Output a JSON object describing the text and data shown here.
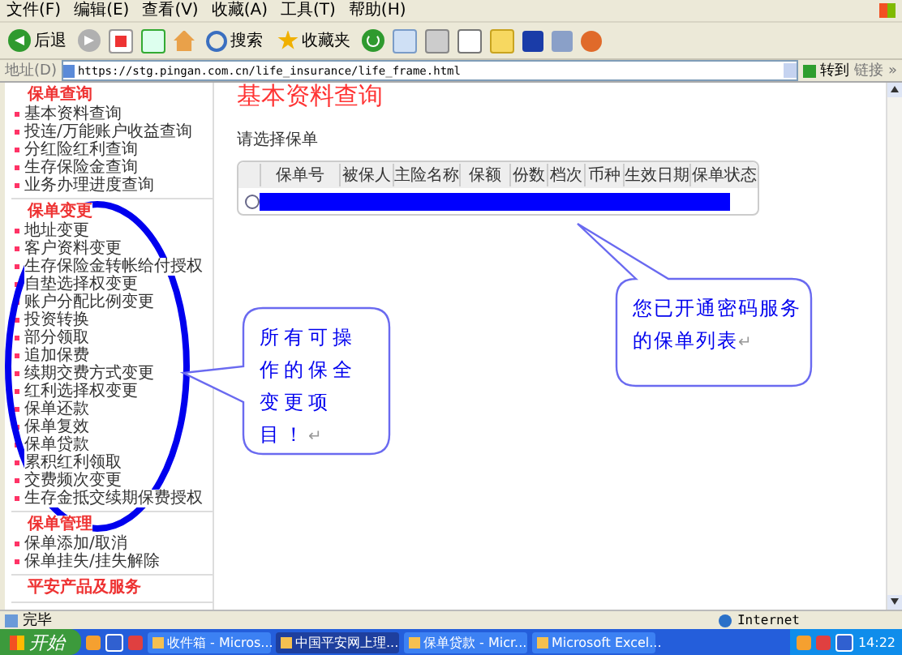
{
  "menu_bar": [
    "文件(F)",
    "编辑(E)",
    "查看(V)",
    "收藏(A)",
    "工具(T)",
    "帮助(H)"
  ],
  "toolbar": {
    "back": "后退",
    "search": "搜索",
    "favorites": "收藏夹"
  },
  "address_bar": {
    "label": "地址(D)",
    "url": "https://stg.pingan.com.cn/life_insurance/life_frame.html",
    "go": "转到",
    "links": "链接",
    "more": "»"
  },
  "sidebar": [
    {
      "title": "保单查询",
      "items": [
        "基本资料查询",
        "投连/万能账户收益查询",
        "分红险红利查询",
        "生存保险金查询",
        "业务办理进度查询"
      ]
    },
    {
      "title": "保单变更",
      "items": [
        "地址变更",
        "客户资料变更",
        "生存保险金转帐给付授权",
        "自垫选择权变更",
        "账户分配比例变更",
        "投资转换",
        "部分领取",
        "追加保费",
        "续期交费方式变更",
        "红利选择权变更",
        "保单还款",
        "保单复效",
        "保单贷款",
        "累积红利领取",
        "交费频次变更",
        "生存金抵交续期保费授权"
      ]
    },
    {
      "title": "保单管理",
      "items": [
        "保单添加/取消",
        "保单挂失/挂失解除"
      ]
    },
    {
      "title": "平安产品及服务"
    }
  ],
  "page_title": "基本资料查询",
  "prompt": "请选择保单",
  "table": {
    "columns": [
      "保单号",
      "被保人",
      "主险名称",
      "保额",
      "份数",
      "档次",
      "币种",
      "生效日期",
      "保单状态"
    ],
    "rows": [
      {
        "selected": false,
        "redacted": true
      }
    ]
  },
  "callouts": [
    {
      "text": "所有可操作的保全变更项目！",
      "mark": "↵"
    },
    {
      "text": "您已开通密码服务的保单列表",
      "mark": "↵"
    }
  ],
  "status_bar": {
    "text": "完毕",
    "zone": "Internet"
  },
  "taskbar": {
    "start": "开始",
    "tasks": [
      {
        "label": "收件箱 - Micros...",
        "selected": false
      },
      {
        "label": "中国平安网上理...",
        "selected": true
      },
      {
        "label": "保单贷款 - Micr...",
        "selected": false
      },
      {
        "label": "Microsoft Excel...",
        "selected": false
      }
    ],
    "clock": "14:22"
  }
}
